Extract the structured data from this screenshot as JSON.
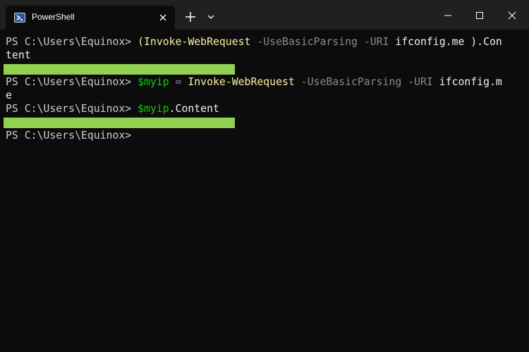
{
  "window": {
    "tab_title": "PowerShell",
    "icons": {
      "tab": "powershell-icon",
      "tab_close": "close-icon",
      "new_tab": "plus-icon",
      "dropdown": "chevron-down-icon",
      "minimize": "minimize-icon",
      "maximize": "maximize-icon",
      "close": "close-icon"
    }
  },
  "terminal": {
    "prompt": "PS C:\\Users\\Equinox> ",
    "line1": {
      "open_paren": "(",
      "cmdlet": "Invoke-WebRequest",
      "param1": " -UseBasicParsing",
      "param2": " -URI",
      "arg": " ifconfig.me ",
      "close": ").Con"
    },
    "line1_wrap": "tent",
    "line3": {
      "var": "$myip",
      "op": " = ",
      "cmdlet": "Invoke-WebRequest",
      "param1": " -UseBasicParsing",
      "param2": " -URI",
      "arg": " ifconfig.m"
    },
    "line3_wrap": "e",
    "line5": {
      "var": "$myip",
      "prop": ".Content"
    },
    "redaction_color": "#92d050"
  },
  "colors": {
    "background": "#0c0c0c",
    "titlebar": "#202020",
    "cmdlet": "#f9f1a5",
    "parameter": "#8a8a8a",
    "variable": "#16c60c",
    "text": "#cccccc"
  }
}
